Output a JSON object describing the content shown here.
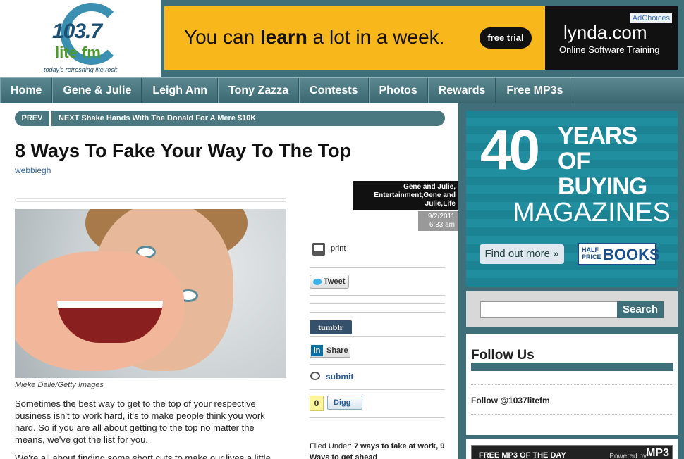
{
  "logo": {
    "number": "103.7",
    "name": "lite fm",
    "tagline": "today's refreshing lite rock"
  },
  "top_ad": {
    "headline_pre": "You can ",
    "headline_bold": "learn",
    "headline_post": " a lot in a week.",
    "cta": "free trial",
    "brand": "lynda.com",
    "brand_sub": "Online Software Training",
    "adchoices": "AdChoices"
  },
  "nav": [
    "Home",
    "Gene & Julie",
    "Leigh Ann",
    "Tony Zazza",
    "Contests",
    "Photos",
    "Rewards",
    "Free MP3s"
  ],
  "prevnext": {
    "prev": "PREV",
    "next": "NEXT Shake Hands With The Donald For A Mere $10K"
  },
  "article": {
    "title": "8 Ways To Fake Your Way To The Top",
    "author": "webbiegh",
    "tags": "Gene and Julie, Entertainment,Gene and Julie,Life",
    "date": "9/2/2011",
    "time": "6:33 am",
    "caption": "Mieke Dalle/Getty Images",
    "paragraphs": [
      "Sometimes the best way to get to the top of your respective business isn't to work hard, it's to make people think you work hard.   So if you are all about getting to the top no matter the means, we've got the list for you.",
      "We're all about finding some short cuts to make our lives a little"
    ]
  },
  "share": {
    "print": "print",
    "tweet": "Tweet",
    "tumblr": "tumblr",
    "linkedin_icon": "in",
    "linkedin": "Share",
    "reddit": "submit",
    "digg_count": "0",
    "digg": "Digg",
    "filed_label": "Filed Under: ",
    "filed_value": "7 ways to fake at work, 9 Ways to get ahead"
  },
  "side_ad": {
    "number": "40",
    "years": "YEARS OF BUYING",
    "magazines": "MAGAZINES",
    "cta": "Find out more »",
    "brand_small": "HALF PRICE",
    "brand_big": "BOOKS"
  },
  "search": {
    "button": "Search",
    "placeholder": ""
  },
  "follow": {
    "title": "Follow Us",
    "link": "Follow @1037litefm"
  },
  "mp3": {
    "label": "FREE MP3 OF THE DAY",
    "powered": "Powered by",
    "logo": "MP3"
  },
  "colors": {
    "teal": "#3f6f78",
    "ad_yellow": "#f8b81b",
    "ad_teal": "#1e8a9c"
  }
}
